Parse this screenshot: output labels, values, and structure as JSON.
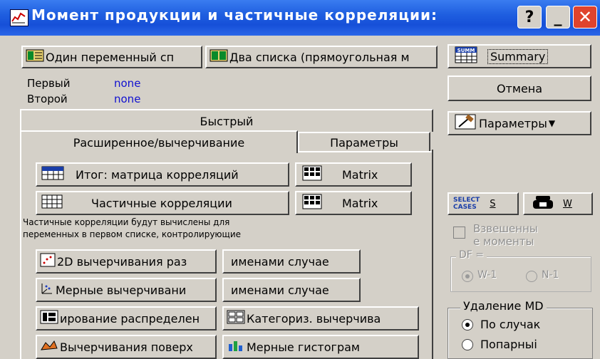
{
  "window": {
    "title": "Момент продукции и частичные корреляции:",
    "help_label": "?",
    "minimize_label": "_",
    "close_label": "✕"
  },
  "variables": {
    "one_list_button": "Один переменный сп",
    "two_lists_button": "Два списка (прямоугольная м",
    "first_label": "Первый",
    "first_value": "none",
    "second_label": "Второй",
    "second_value": "none"
  },
  "side": {
    "summary_label": "Summary",
    "summary_icon_text": "SUMM",
    "cancel_label": "Отмена",
    "options_label": "Параметры",
    "select_cases_icon_line1": "SELECT",
    "select_cases_icon_line2": "CASES",
    "select_cases_label": "S",
    "weight_label": "W"
  },
  "tabs": {
    "quick": "Быстрый",
    "advanced": "Расширенное/вычерчивание",
    "options": "Параметры"
  },
  "advanced_tab": {
    "summary_matrix_label": "Итог: матрица корреляций",
    "matrix_label_1": "Matrix",
    "partial_corr_label": "Частичные корреляции",
    "matrix_label_2": "Matrix",
    "note_line1": "Частичные корреляции будут вычислены для",
    "note_line2": "переменных в первом списке, контролирующие",
    "scatter2d_label": "2D вычерчивания раз",
    "case_names_label_1": "именами случае",
    "scatter3d_label": "Мерные вычерчивани",
    "case_names_label_2": "именами случае",
    "histograms_label": "ирование распределен",
    "categorized_label": "Категориз. вычерчива",
    "row5_left_label": "Вычерчивания поверх",
    "row5_right_label": "Мерные гистограм"
  },
  "weighted": {
    "label_line1": "Взвешенны",
    "label_line2": "е моменты",
    "df_label": "DF =",
    "w1_label": "W-1",
    "n1_label": "N-1"
  },
  "md_deletion": {
    "title": "Удаление MD",
    "casewise_label": "По случак",
    "pairwise_label": "Попарныі",
    "selected": "casewise"
  },
  "colors": {
    "title_bar": "#1f5fe0",
    "value_text": "#1010d0",
    "close_button": "#e0432d",
    "face": "#d4d0c8"
  }
}
